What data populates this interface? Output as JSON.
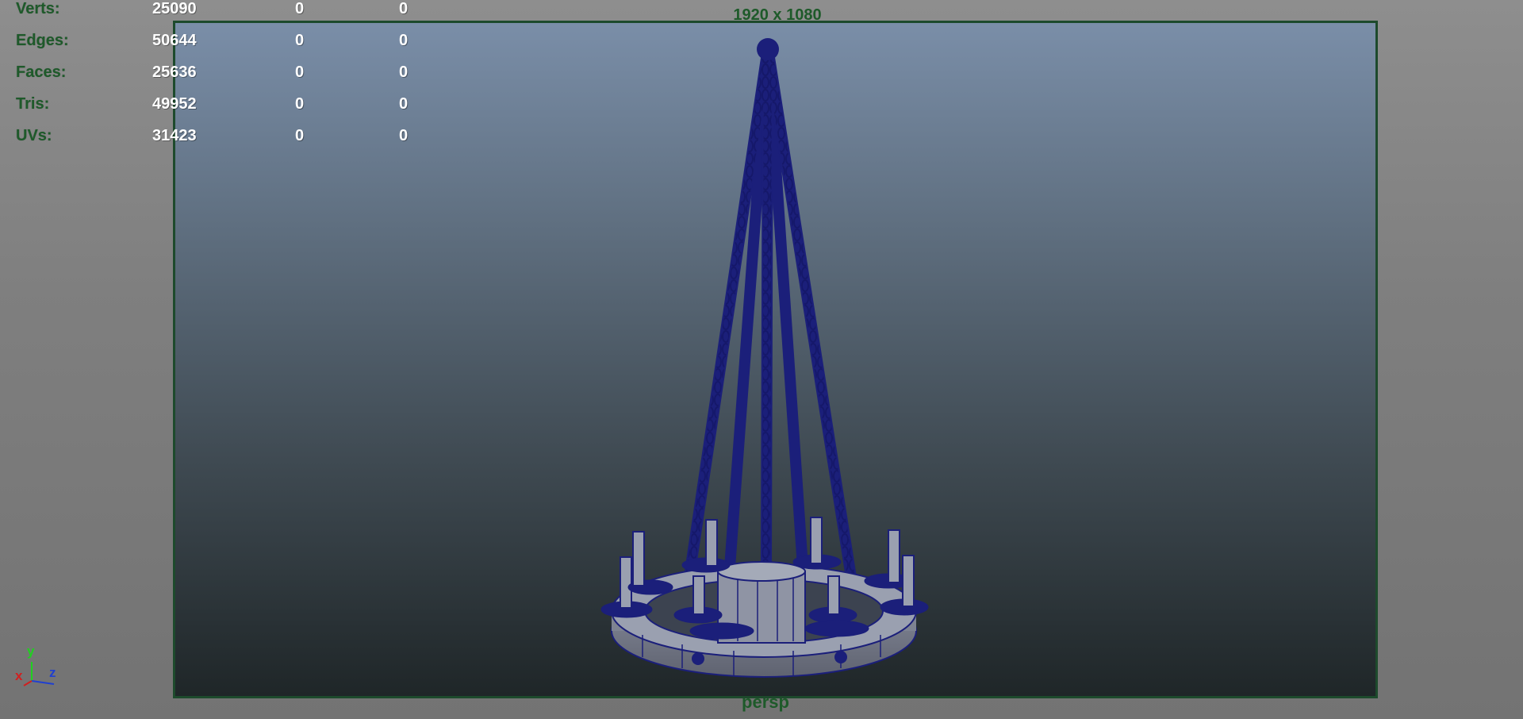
{
  "hud": {
    "rows": [
      {
        "label": "Verts:",
        "v1": "25090",
        "v2": "0",
        "v3": "0"
      },
      {
        "label": "Edges:",
        "v1": "50644",
        "v2": "0",
        "v3": "0"
      },
      {
        "label": "Faces:",
        "v1": "25636",
        "v2": "0",
        "v3": "0"
      },
      {
        "label": "Tris:",
        "v1": "49952",
        "v2": "0",
        "v3": "0"
      },
      {
        "label": "UVs:",
        "v1": "31423",
        "v2": "0",
        "v3": "0"
      }
    ]
  },
  "viewport": {
    "resolution_gate": "1920 x 1080",
    "camera": "persp",
    "background_top": "#7a8ea8",
    "background_bottom": "#1f2628",
    "gate_border": "#1d4a2c",
    "wireframe_color": "#1b1f7a"
  },
  "axis": {
    "x": "x",
    "y": "y",
    "z": "z",
    "x_color": "#d02020",
    "y_color": "#20d020",
    "z_color": "#2040d0"
  },
  "model": {
    "icon": "chandelier-model"
  }
}
